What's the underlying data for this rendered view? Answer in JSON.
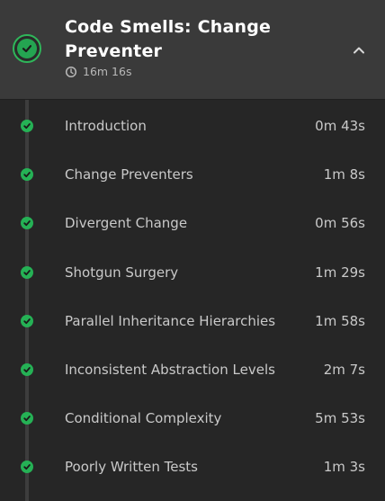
{
  "module": {
    "title": "Code Smells: Change Preventer",
    "duration": "16m 16s",
    "status_icon": "check-circle-icon",
    "toggle_icon": "chevron-up-icon",
    "accent_color": "#2fb65a"
  },
  "clips": [
    {
      "title": "Introduction",
      "duration": "0m 43s",
      "completed": true
    },
    {
      "title": "Change Preventers",
      "duration": "1m 8s",
      "completed": true
    },
    {
      "title": "Divergent Change",
      "duration": "0m 56s",
      "completed": true
    },
    {
      "title": "Shotgun Surgery",
      "duration": "1m 29s",
      "completed": true
    },
    {
      "title": "Parallel Inheritance Hierarchies",
      "duration": "1m 58s",
      "completed": true
    },
    {
      "title": "Inconsistent Abstraction Levels",
      "duration": "2m 7s",
      "completed": true
    },
    {
      "title": "Conditional Complexity",
      "duration": "5m 53s",
      "completed": true
    },
    {
      "title": "Poorly Written Tests",
      "duration": "1m 3s",
      "completed": true
    }
  ]
}
